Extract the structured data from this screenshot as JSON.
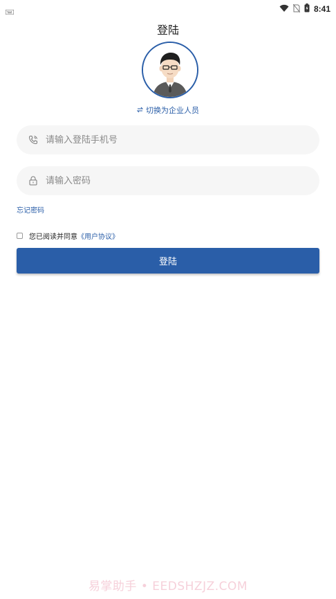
{
  "status_bar": {
    "time": "8:41",
    "icons": [
      "keyboard-icon",
      "wifi-icon",
      "no-sim-icon",
      "battery-charging-icon"
    ]
  },
  "page": {
    "title": "登陆"
  },
  "switch_role": {
    "icon": "swap-icon",
    "label": "切换为企业人员"
  },
  "form": {
    "phone": {
      "placeholder": "请输入登陆手机号",
      "value": "",
      "icon": "phone-icon"
    },
    "password": {
      "placeholder": "请输入密码",
      "value": "",
      "icon": "lock-icon"
    },
    "forgot_password_label": "忘记密码",
    "agreement": {
      "checked": false,
      "text": "您已阅读并同意",
      "link_label": "《用户协议》"
    },
    "login_label": "登陆"
  },
  "colors": {
    "primary": "#2a5ea8",
    "input_bg": "#f6f6f6",
    "watermark": "#e6789a"
  },
  "watermark": {
    "text": "易掌助手 • EEDSHZJZ.COM"
  }
}
